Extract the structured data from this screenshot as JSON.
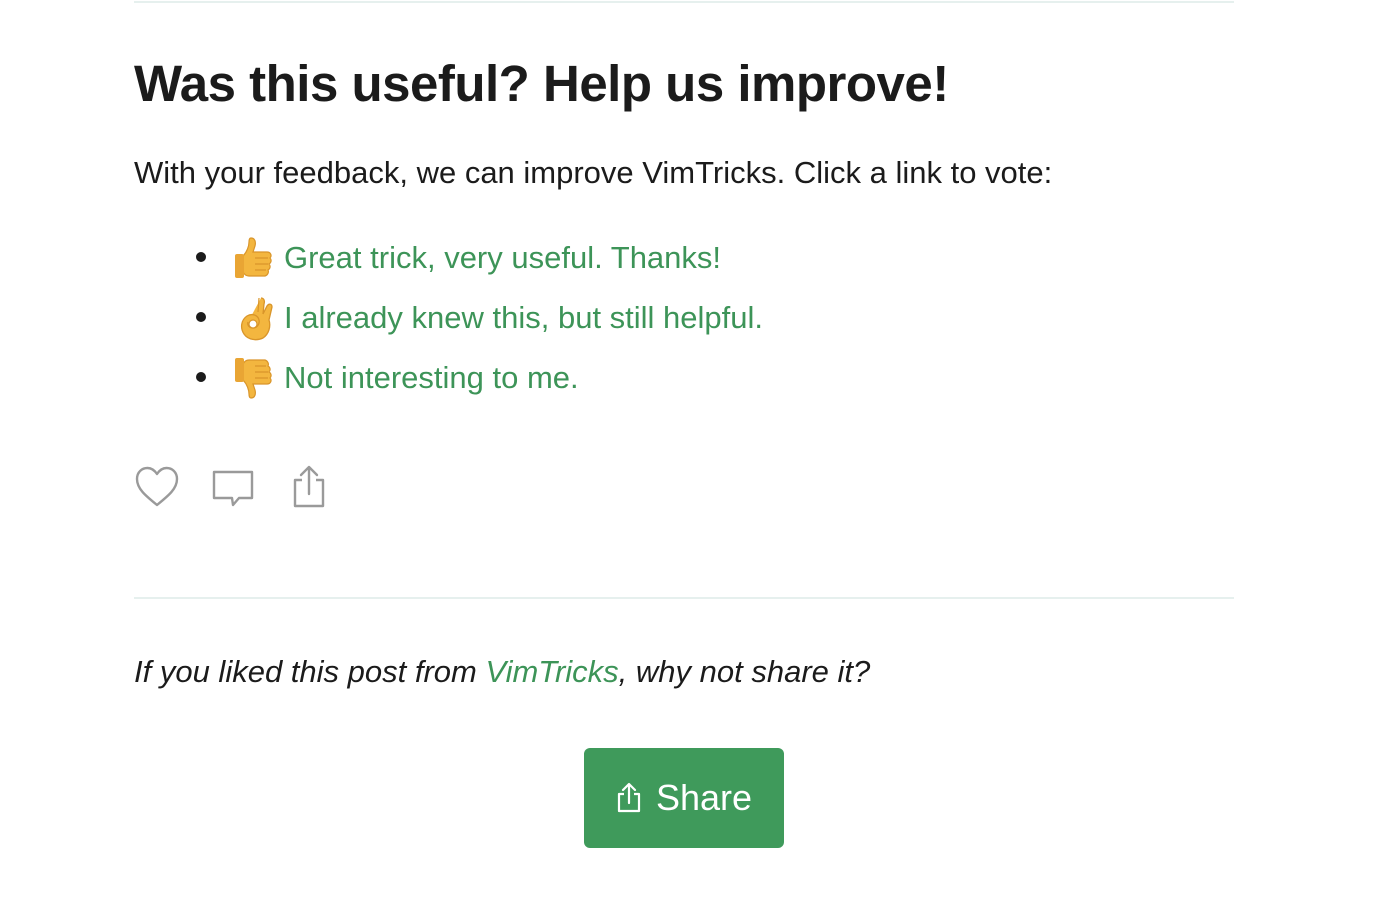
{
  "feedback": {
    "title": "Was this useful? Help us improve!",
    "intro": "With your feedback, we can improve VimTricks. Click a link to vote:",
    "votes": [
      {
        "icon": "thumbs-up-icon",
        "label": "Great trick, very useful. Thanks!"
      },
      {
        "icon": "ok-hand-icon",
        "label": "I already knew this, but still helpful."
      },
      {
        "icon": "thumbs-down-icon",
        "label": "Not interesting to me."
      }
    ]
  },
  "actions": [
    {
      "icon": "heart-icon"
    },
    {
      "icon": "comment-icon"
    },
    {
      "icon": "share-icon"
    }
  ],
  "share_note": {
    "before": "If you liked this post from ",
    "link": "VimTricks",
    "after": ", why not share it?"
  },
  "share_button": {
    "label": "Share",
    "icon": "share-icon"
  },
  "colors": {
    "link": "#3d9458",
    "button": "#3f9a5b",
    "rule": "#e6f0ee",
    "icon": "#9a9a9a"
  }
}
